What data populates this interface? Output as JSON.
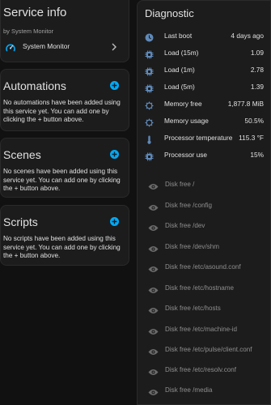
{
  "service_info": {
    "title": "Service info",
    "byline": "by System Monitor",
    "link_label": "System Monitor"
  },
  "automations": {
    "title": "Automations",
    "description": "No automations have been added using this service yet. You can add one by clicking the + button above."
  },
  "scenes": {
    "title": "Scenes",
    "description": "No scenes have been added using this service yet. You can add one by clicking the + button above."
  },
  "scripts": {
    "title": "Scripts",
    "description": "No scripts have been added using this service yet. You can add one by clicking the + button above."
  },
  "diagnostic": {
    "title": "Diagnostic",
    "sensors": [
      {
        "icon": "clock-icon",
        "name": "Last boot",
        "value": "4 days ago"
      },
      {
        "icon": "cpu-icon",
        "name": "Load (15m)",
        "value": "1.09"
      },
      {
        "icon": "cpu-icon",
        "name": "Load (1m)",
        "value": "2.78"
      },
      {
        "icon": "cpu-icon",
        "name": "Load (5m)",
        "value": "1.39"
      },
      {
        "icon": "memory-icon",
        "name": "Memory free",
        "value": "1,877.8 MiB"
      },
      {
        "icon": "memory-icon",
        "name": "Memory usage",
        "value": "50.5%"
      },
      {
        "icon": "thermometer-icon",
        "name": "Processor temperature",
        "value": "115.3 °F"
      },
      {
        "icon": "cpu-icon",
        "name": "Processor use",
        "value": "15%"
      }
    ],
    "disabled": [
      "Disk free /",
      "Disk free /config",
      "Disk free /dev",
      "Disk free /dev/shm",
      "Disk free /etc/asound.conf",
      "Disk free /etc/hostname",
      "Disk free /etc/hosts",
      "Disk free /etc/machine-id",
      "Disk free /etc/pulse/client.conf",
      "Disk free /etc/resolv.conf",
      "Disk free /media"
    ]
  },
  "colors": {
    "accent": "#03a9f4",
    "icon": "#5f89b8",
    "disabled_icon": "#6b6b6b"
  }
}
